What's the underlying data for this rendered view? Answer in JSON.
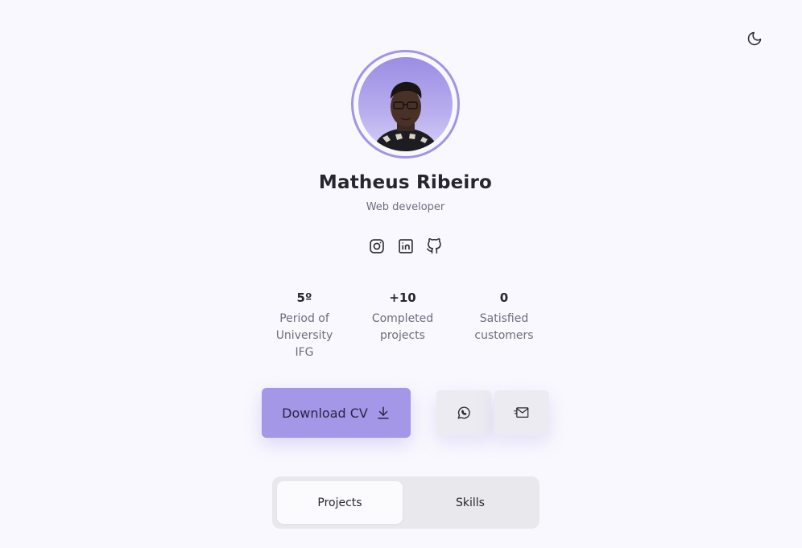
{
  "profile": {
    "name": "Matheus Ribeiro",
    "role": "Web developer"
  },
  "social_links": [
    {
      "icon": "instagram-icon"
    },
    {
      "icon": "linkedin-icon"
    },
    {
      "icon": "github-icon"
    }
  ],
  "stats": [
    {
      "value": "5º",
      "label": "Period of University IFG"
    },
    {
      "value": "+10",
      "label": "Completed projects"
    },
    {
      "value": "0",
      "label": "Satisfied customers"
    }
  ],
  "actions": {
    "download_label": "Download CV",
    "download_icon": "download-icon",
    "whatsapp_icon": "whatsapp-icon",
    "email_icon": "send-mail-icon"
  },
  "tabs": [
    {
      "label": "Projects",
      "active": true
    },
    {
      "label": "Skills",
      "active": false
    }
  ],
  "theme_toggle_icon": "moon-icon",
  "colors": {
    "accent": "#a497e8",
    "background": "#f9f8fe",
    "text": "#27252e",
    "muted_text": "#6f6c7d"
  }
}
